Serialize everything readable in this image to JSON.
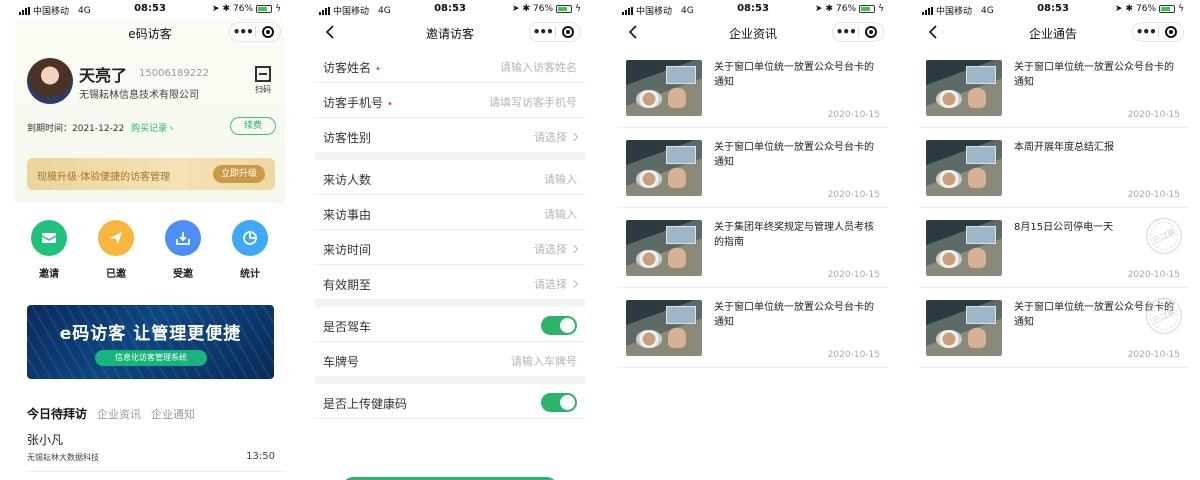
{
  "status": {
    "carrier": "中国移动",
    "network": "4G",
    "time": "08:53",
    "battery": "76%",
    "battery_level": 0.76
  },
  "colors": {
    "accent": "#2db36e",
    "gold": "#c99a48"
  },
  "screen1": {
    "app_title": "e码访客",
    "user": {
      "name": "天亮了",
      "phone": "15006189222",
      "company": "无锡耘林信息技术有限公司"
    },
    "scan_label": "扫码",
    "expire": "到期时间：2021-12-22",
    "records": "购买记录 ›",
    "renew": "续费",
    "upgrade_text": "现模升级·体验便捷的访客管理",
    "upgrade_button": "立即升级",
    "features": [
      {
        "label": "邀请",
        "icon": "envelope-icon",
        "color": "#22c27a"
      },
      {
        "label": "已邀",
        "icon": "send-icon",
        "color": "#f6b73c"
      },
      {
        "label": "受邀",
        "icon": "inbox-icon",
        "color": "#4d8ef5"
      },
      {
        "label": "统计",
        "icon": "chart-icon",
        "color": "#3fa9f5"
      }
    ],
    "banner_title": "e码访客 让管理更便捷",
    "banner_pill": "信息化访客管理系统",
    "tabs": [
      "今日待拜访",
      "企业资讯",
      "企业通知"
    ],
    "visitor": {
      "name": "张小凡",
      "company": "无锡耘林大数据科技",
      "time": "13:50"
    }
  },
  "screen2": {
    "title": "邀请访客",
    "rows": [
      {
        "label": "访客姓名",
        "required": "•",
        "value": "请输入访客姓名"
      },
      {
        "label": "访客手机号",
        "required": "•",
        "value": "请填写访客手机号"
      },
      {
        "label": "访客性别",
        "value": "请选择"
      },
      {
        "label": "来访人数",
        "value": "请输入"
      },
      {
        "label": "来访事由",
        "value": "请输入"
      },
      {
        "label": "来访时间",
        "value": "请选择"
      },
      {
        "label": "有效期至",
        "value": "请选择"
      },
      {
        "label": "是否驾车"
      },
      {
        "label": "车牌号",
        "value": "请输入车牌号"
      },
      {
        "label": "是否上传健康码"
      }
    ]
  },
  "screen3": {
    "title": "企业资讯",
    "items": [
      {
        "title": "关于窗口单位统一放置公众号台卡的通知",
        "date": "2020-10-15"
      },
      {
        "title": "关于窗口单位统一放置公众号台卡的通知",
        "date": "2020-10-15"
      },
      {
        "title": "关于集团年终奖规定与管理人员考核的指南",
        "date": "2020-10-15"
      },
      {
        "title": "关于窗口单位统一放置公众号台卡的通知",
        "date": "2020-10-15"
      }
    ]
  },
  "screen4": {
    "title": "企业通告",
    "stamp_label": "已过期",
    "items": [
      {
        "title": "关于窗口单位统一放置公众号台卡的通知",
        "date": "2020-10-15"
      },
      {
        "title": "本周开展年度总结汇报",
        "date": "2020-10-15"
      },
      {
        "title": "8月15日公司停电一天",
        "date": "2020-10-15"
      },
      {
        "title": "关于窗口单位统一放置公众号台卡的通知",
        "date": "2020-10-15"
      }
    ]
  }
}
